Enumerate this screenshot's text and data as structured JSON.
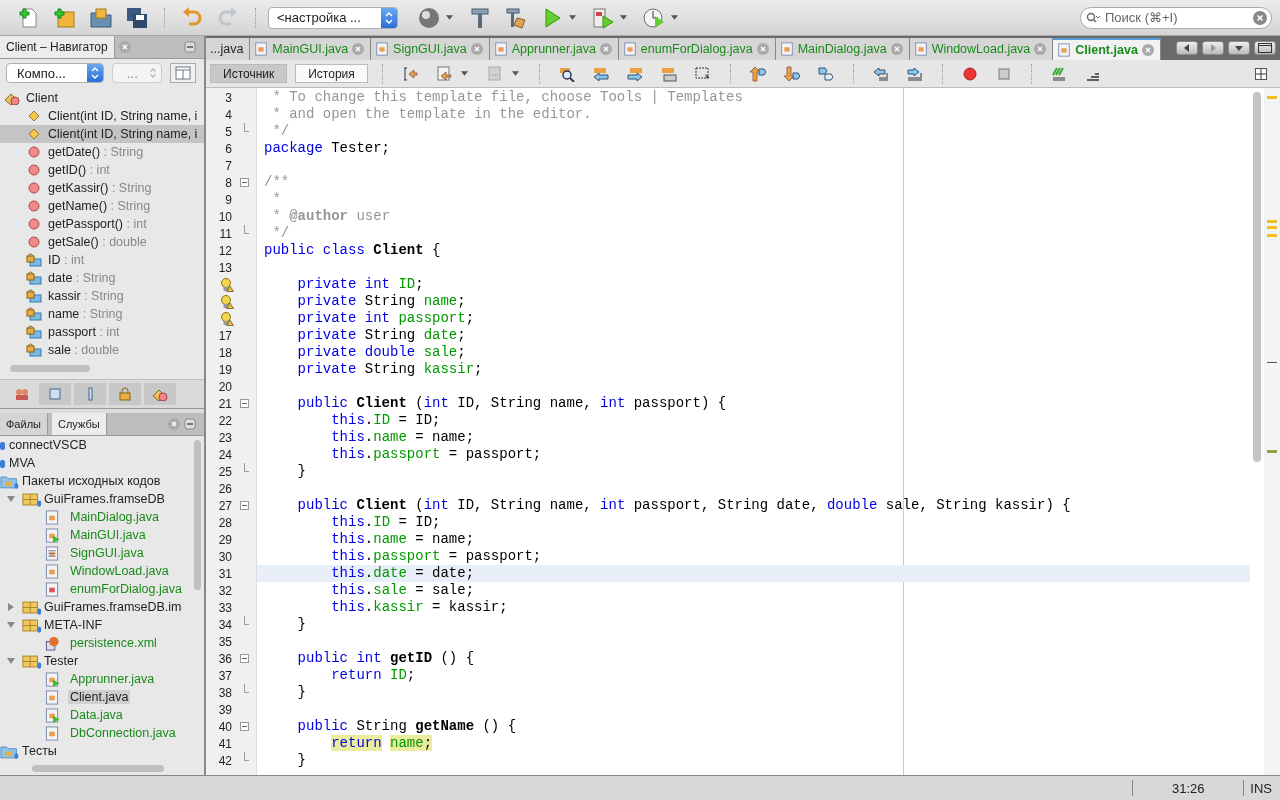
{
  "toolbar": {
    "config_select": "<настройка ...",
    "search": {
      "placeholder": "Поиск (⌘+I)"
    }
  },
  "navigator": {
    "title": "Client – Навигатор",
    "filter_select": "Компо...",
    "second_select": "...",
    "items": [
      {
        "kind": "class",
        "name": "Client",
        "selected": false,
        "children": [
          {
            "kind": "constructor",
            "name": "Client(int ID, String name, i",
            "selected": false
          },
          {
            "kind": "constructor",
            "name": "Client(int ID, String name, i",
            "selected": true
          },
          {
            "kind": "method",
            "name": "getDate()",
            "type": " : String",
            "selected": false
          },
          {
            "kind": "method",
            "name": "getID()",
            "type": " : int",
            "selected": false
          },
          {
            "kind": "method",
            "name": "getKassir()",
            "type": " : String",
            "selected": false
          },
          {
            "kind": "method",
            "name": "getName()",
            "type": " : String",
            "selected": false
          },
          {
            "kind": "method",
            "name": "getPassport()",
            "type": " : int",
            "selected": false
          },
          {
            "kind": "method",
            "name": "getSale()",
            "type": " : double",
            "selected": false
          },
          {
            "kind": "field",
            "name": "ID",
            "type": " : int",
            "selected": false
          },
          {
            "kind": "field",
            "name": "date",
            "type": " : String",
            "selected": false
          },
          {
            "kind": "field",
            "name": "kassir",
            "type": " : String",
            "selected": false
          },
          {
            "kind": "field",
            "name": "name",
            "type": " : String",
            "selected": false
          },
          {
            "kind": "field",
            "name": "passport",
            "type": " : int",
            "selected": false
          },
          {
            "kind": "field",
            "name": "sale",
            "type": " : double",
            "selected": false
          }
        ]
      }
    ]
  },
  "files_panel": {
    "tabs": [
      {
        "label": "Файлы",
        "selected": false
      },
      {
        "label": "Службы",
        "selected": true
      }
    ],
    "tree": [
      {
        "kind": "project",
        "label": "connectVSCB",
        "selected": false
      },
      {
        "kind": "project",
        "label": "MVA",
        "selected": false
      },
      {
        "kind": "folder",
        "label": "Пакеты исходных кодов",
        "selected": false,
        "children": [
          {
            "kind": "package",
            "label": "GuiFrames.framseDB",
            "selected": false,
            "expanded": true,
            "children": [
              {
                "kind": "form",
                "label": "MainDialog.java",
                "selected": false
              },
              {
                "kind": "runnable",
                "label": "MainGUI.java",
                "selected": false
              },
              {
                "kind": "file",
                "label": "SignGUI.java",
                "selected": false
              },
              {
                "kind": "form",
                "label": "WindowLoad.java",
                "selected": false
              },
              {
                "kind": "enum",
                "label": "enumForDialog.java",
                "selected": false
              }
            ]
          },
          {
            "kind": "package",
            "label": "GuiFrames.framseDB.im",
            "selected": false,
            "expanded": false
          },
          {
            "kind": "package",
            "label": "META-INF",
            "selected": false,
            "expanded": true,
            "children": [
              {
                "kind": "xml",
                "label": "persistence.xml",
                "selected": false
              }
            ]
          },
          {
            "kind": "package",
            "label": "Tester",
            "selected": false,
            "expanded": true,
            "children": [
              {
                "kind": "runnable",
                "label": "Apprunner.java",
                "selected": false
              },
              {
                "kind": "form",
                "label": "Client.java",
                "selected": true
              },
              {
                "kind": "runnable",
                "label": "Data.java",
                "selected": false
              },
              {
                "kind": "form",
                "label": "DbConnection.java",
                "selected": false
              }
            ]
          }
        ]
      },
      {
        "kind": "folder",
        "label": "Тесты",
        "selected": false
      }
    ]
  },
  "editor": {
    "tabs": [
      {
        "label": "...java",
        "selected": false,
        "closable": false
      },
      {
        "label": "MainGUI.java",
        "selected": false,
        "closable": true
      },
      {
        "label": "SignGUI.java",
        "selected": false,
        "closable": true
      },
      {
        "label": "Apprunner.java",
        "selected": false,
        "closable": true
      },
      {
        "label": "enumForDialog.java",
        "selected": false,
        "closable": true
      },
      {
        "label": "MainDialog.java",
        "selected": false,
        "closable": true
      },
      {
        "label": "WindowLoad.java",
        "selected": false,
        "closable": true
      },
      {
        "label": "Client.java",
        "selected": true,
        "closable": true
      }
    ],
    "views": [
      {
        "label": "Источник",
        "selected": true
      },
      {
        "label": "История",
        "selected": false
      }
    ],
    "lines": [
      {
        "number": "3",
        "kind": "plain",
        "current": false,
        "marked": false,
        "segments": [
          {
            "kind": "comment",
            "text": " * To change this template file, choose Tools | Templates"
          }
        ]
      },
      {
        "number": "4",
        "kind": "plain",
        "current": false,
        "marked": false,
        "segments": [
          {
            "kind": "comment",
            "text": " * and open the template in the editor."
          }
        ]
      },
      {
        "number": "5",
        "kind": "fold-end",
        "current": false,
        "marked": false,
        "segments": [
          {
            "kind": "comment",
            "text": " */"
          }
        ]
      },
      {
        "number": "6",
        "kind": "plain",
        "current": false,
        "marked": false,
        "segments": [
          {
            "kind": "keyword",
            "text": "package"
          },
          {
            "kind": "plain",
            "text": " Tester;"
          }
        ]
      },
      {
        "number": "7",
        "kind": "plain",
        "current": false,
        "marked": false
      },
      {
        "number": "8",
        "kind": "fold-start",
        "current": false,
        "marked": false,
        "segments": [
          {
            "kind": "comment",
            "text": "/**"
          }
        ]
      },
      {
        "number": "9",
        "kind": "plain",
        "current": false,
        "marked": false,
        "segments": [
          {
            "kind": "comment",
            "text": " *"
          }
        ]
      },
      {
        "number": "10",
        "kind": "plain",
        "current": false,
        "marked": false,
        "segments": [
          {
            "kind": "comment",
            "text": " *"
          },
          {
            "kind": "doctag",
            "text": " @author"
          },
          {
            "kind": "comment",
            "text": " user"
          }
        ]
      },
      {
        "number": "11",
        "kind": "fold-end",
        "current": false,
        "marked": false,
        "segments": [
          {
            "kind": "comment",
            "text": " */"
          }
        ]
      },
      {
        "number": "12",
        "kind": "plain",
        "current": false,
        "marked": false,
        "segments": [
          {
            "kind": "keyword",
            "text": "public class"
          },
          {
            "kind": "bold",
            "text": " Client"
          },
          {
            "kind": "plain",
            "text": " {"
          }
        ]
      },
      {
        "number": "13",
        "kind": "plain",
        "current": false,
        "marked": false
      },
      {
        "kind": "hint",
        "current": false,
        "marked": false,
        "segments": [
          {
            "kind": "keyword",
            "text": "    private int"
          },
          {
            "kind": "field",
            "text": " ID"
          },
          {
            "kind": "plain",
            "text": ";"
          }
        ]
      },
      {
        "kind": "hint",
        "current": false,
        "marked": false,
        "segments": [
          {
            "kind": "keyword",
            "text": "    private"
          },
          {
            "kind": "plain",
            "text": " String"
          },
          {
            "kind": "field",
            "text": " name"
          },
          {
            "kind": "plain",
            "text": ";"
          }
        ]
      },
      {
        "kind": "hint",
        "current": false,
        "marked": false,
        "segments": [
          {
            "kind": "keyword",
            "text": "    private int"
          },
          {
            "kind": "field",
            "text": " passport"
          },
          {
            "kind": "plain",
            "text": ";"
          }
        ]
      },
      {
        "number": "17",
        "kind": "plain",
        "current": false,
        "marked": false,
        "segments": [
          {
            "kind": "keyword",
            "text": "    private"
          },
          {
            "kind": "plain",
            "text": " String"
          },
          {
            "kind": "field",
            "text": " date"
          },
          {
            "kind": "plain",
            "text": ";"
          }
        ]
      },
      {
        "number": "18",
        "kind": "plain",
        "current": false,
        "marked": false,
        "segments": [
          {
            "kind": "keyword",
            "text": "    private double"
          },
          {
            "kind": "field",
            "text": " sale"
          },
          {
            "kind": "plain",
            "text": ";"
          }
        ]
      },
      {
        "number": "19",
        "kind": "plain",
        "current": false,
        "marked": false,
        "segments": [
          {
            "kind": "keyword",
            "text": "    private"
          },
          {
            "kind": "plain",
            "text": " String"
          },
          {
            "kind": "field",
            "text": " kassir"
          },
          {
            "kind": "plain",
            "text": ";"
          }
        ]
      },
      {
        "number": "20",
        "kind": "plain",
        "current": false,
        "marked": false
      },
      {
        "number": "21",
        "kind": "fold-start",
        "current": false,
        "marked": false,
        "segments": [
          {
            "kind": "keyword",
            "text": "    public"
          },
          {
            "kind": "bold",
            "text": " Client"
          },
          {
            "kind": "plain",
            "text": " ("
          },
          {
            "kind": "keyword",
            "text": "int"
          },
          {
            "kind": "plain",
            "text": " ID, String name, "
          },
          {
            "kind": "keyword",
            "text": "int"
          },
          {
            "kind": "plain",
            "text": " passport) {"
          }
        ]
      },
      {
        "number": "22",
        "kind": "plain",
        "current": false,
        "marked": false,
        "segments": [
          {
            "kind": "keyword",
            "text": "        this"
          },
          {
            "kind": "plain",
            "text": "."
          },
          {
            "kind": "field",
            "text": "ID"
          },
          {
            "kind": "plain",
            "text": " = ID;"
          }
        ]
      },
      {
        "number": "23",
        "kind": "plain",
        "current": false,
        "marked": false,
        "segments": [
          {
            "kind": "keyword",
            "text": "        this"
          },
          {
            "kind": "plain",
            "text": "."
          },
          {
            "kind": "field",
            "text": "name"
          },
          {
            "kind": "plain",
            "text": " = name;"
          }
        ]
      },
      {
        "number": "24",
        "kind": "plain",
        "current": false,
        "marked": false,
        "segments": [
          {
            "kind": "keyword",
            "text": "        this"
          },
          {
            "kind": "plain",
            "text": "."
          },
          {
            "kind": "field",
            "text": "passport"
          },
          {
            "kind": "plain",
            "text": " = passport;"
          }
        ]
      },
      {
        "number": "25",
        "kind": "fold-end",
        "current": false,
        "marked": false,
        "segments": [
          {
            "kind": "plain",
            "text": "    }"
          }
        ]
      },
      {
        "number": "26",
        "kind": "plain",
        "current": false,
        "marked": false
      },
      {
        "number": "27",
        "kind": "fold-start",
        "current": false,
        "marked": false,
        "segments": [
          {
            "kind": "keyword",
            "text": "    public"
          },
          {
            "kind": "bold",
            "text": " Client"
          },
          {
            "kind": "plain",
            "text": " ("
          },
          {
            "kind": "keyword",
            "text": "int"
          },
          {
            "kind": "plain",
            "text": " ID, String name, "
          },
          {
            "kind": "keyword",
            "text": "int"
          },
          {
            "kind": "plain",
            "text": " passport, String date, "
          },
          {
            "kind": "keyword",
            "text": "double"
          },
          {
            "kind": "plain",
            "text": " sale, String kassir) {"
          }
        ]
      },
      {
        "number": "28",
        "kind": "plain",
        "current": false,
        "marked": false,
        "segments": [
          {
            "kind": "keyword",
            "text": "        this"
          },
          {
            "kind": "plain",
            "text": "."
          },
          {
            "kind": "field",
            "text": "ID"
          },
          {
            "kind": "plain",
            "text": " = ID;"
          }
        ]
      },
      {
        "number": "29",
        "kind": "plain",
        "current": false,
        "marked": false,
        "segments": [
          {
            "kind": "keyword",
            "text": "        this"
          },
          {
            "kind": "plain",
            "text": "."
          },
          {
            "kind": "field",
            "text": "name"
          },
          {
            "kind": "plain",
            "text": " = name;"
          }
        ]
      },
      {
        "number": "30",
        "kind": "plain",
        "current": false,
        "marked": false,
        "segments": [
          {
            "kind": "keyword",
            "text": "        this"
          },
          {
            "kind": "plain",
            "text": "."
          },
          {
            "kind": "field",
            "text": "passport"
          },
          {
            "kind": "plain",
            "text": " = passport;"
          }
        ]
      },
      {
        "number": "31",
        "kind": "plain",
        "current": true,
        "marked": false,
        "segments": [
          {
            "kind": "keyword",
            "text": "        this"
          },
          {
            "kind": "plain",
            "text": "."
          },
          {
            "kind": "field",
            "text": "date"
          },
          {
            "kind": "plain",
            "text": " = date;"
          }
        ]
      },
      {
        "number": "32",
        "kind": "plain",
        "current": false,
        "marked": false,
        "segments": [
          {
            "kind": "keyword",
            "text": "        this"
          },
          {
            "kind": "plain",
            "text": "."
          },
          {
            "kind": "field",
            "text": "sale"
          },
          {
            "kind": "plain",
            "text": " = sale;"
          }
        ]
      },
      {
        "number": "33",
        "kind": "plain",
        "current": false,
        "marked": false,
        "segments": [
          {
            "kind": "keyword",
            "text": "        this"
          },
          {
            "kind": "plain",
            "text": "."
          },
          {
            "kind": "field",
            "text": "kassir"
          },
          {
            "kind": "plain",
            "text": " = kassir;"
          }
        ]
      },
      {
        "number": "34",
        "kind": "fold-end",
        "current": false,
        "marked": false,
        "segments": [
          {
            "kind": "plain",
            "text": "    }"
          }
        ]
      },
      {
        "number": "35",
        "kind": "plain",
        "current": false,
        "marked": false
      },
      {
        "number": "36",
        "kind": "fold-start",
        "current": false,
        "marked": false,
        "segments": [
          {
            "kind": "keyword",
            "text": "    public int"
          },
          {
            "kind": "bold",
            "text": " getID"
          },
          {
            "kind": "plain",
            "text": " () {"
          }
        ]
      },
      {
        "number": "37",
        "kind": "plain",
        "current": false,
        "marked": false,
        "segments": [
          {
            "kind": "keyword",
            "text": "        return"
          },
          {
            "kind": "field",
            "text": " ID"
          },
          {
            "kind": "plain",
            "text": ";"
          }
        ]
      },
      {
        "number": "38",
        "kind": "fold-end",
        "current": false,
        "marked": false,
        "segments": [
          {
            "kind": "plain",
            "text": "    }"
          }
        ]
      },
      {
        "number": "39",
        "kind": "plain",
        "current": false,
        "marked": false
      },
      {
        "number": "40",
        "kind": "fold-start",
        "current": false,
        "marked": false,
        "segments": [
          {
            "kind": "keyword",
            "text": "    public"
          },
          {
            "kind": "plain",
            "text": " String"
          },
          {
            "kind": "bold",
            "text": " getName"
          },
          {
            "kind": "plain",
            "text": " () {"
          }
        ]
      },
      {
        "number": "41",
        "kind": "plain",
        "current": false,
        "marked": true,
        "segments": [
          {
            "kind": "keyword",
            "text": "        return"
          },
          {
            "kind": "field",
            "text": " name"
          },
          {
            "kind": "plain",
            "text": ";"
          }
        ]
      },
      {
        "number": "42",
        "kind": "fold-end",
        "current": false,
        "marked": false,
        "segments": [
          {
            "kind": "plain",
            "text": "    }"
          }
        ]
      }
    ]
  },
  "status_bar": {
    "position": "31:26",
    "mode": "INS"
  }
}
